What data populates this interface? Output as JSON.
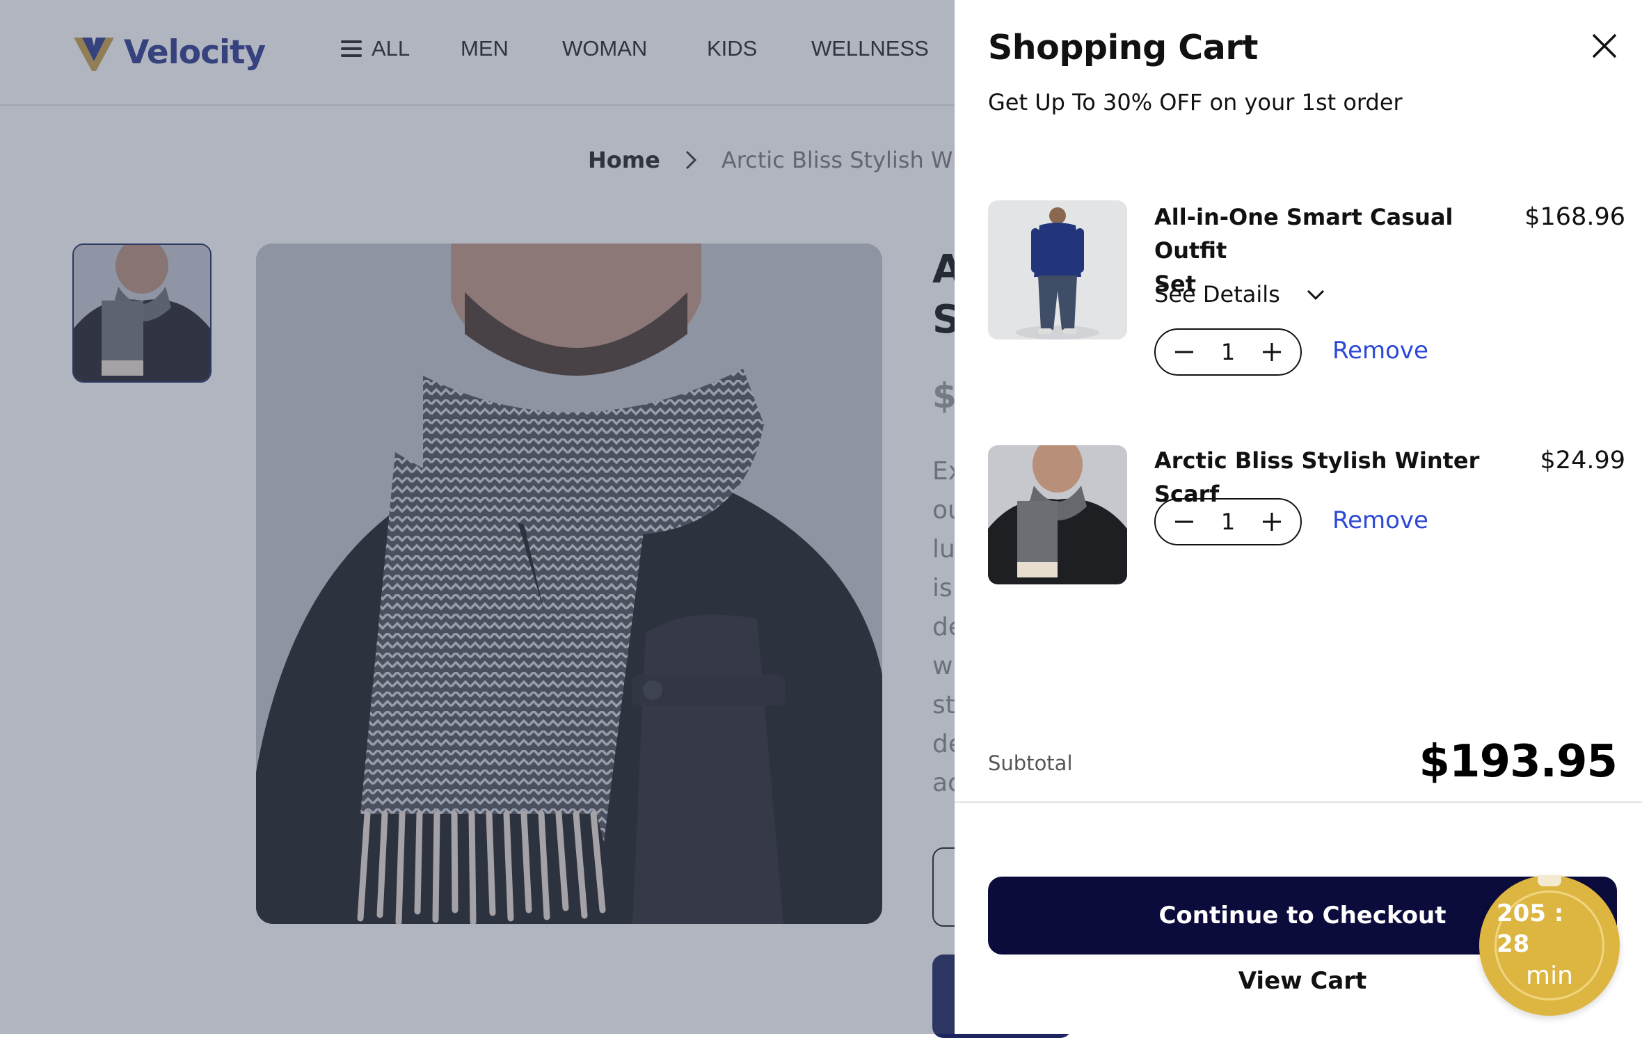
{
  "site": {
    "logo_text": "Velocity",
    "nav": [
      "ALL",
      "MEN",
      "WOMAN",
      "KIDS",
      "WELLNESS"
    ]
  },
  "breadcrumb": {
    "home": "Home",
    "current": "Arctic Bliss Stylish Win"
  },
  "product": {
    "title_line1": "A",
    "title_line2": "S",
    "price_fragment": "$",
    "desc_fragments": [
      "Ex",
      "ou",
      "lu",
      "is",
      "de",
      "w",
      "st",
      "de",
      "ac"
    ]
  },
  "cart": {
    "title": "Shopping Cart",
    "promo": "Get Up To 30% OFF on your 1st order",
    "items": [
      {
        "name": "All-in-One Smart Casual Outfit Set",
        "name_line1": "All-in-One Smart Casual Outfit",
        "name_line2": "Set",
        "price": "$168.96",
        "details_label": "See Details",
        "quantity": "1",
        "remove_label": "Remove"
      },
      {
        "name": "Arctic Bliss Stylish Winter Scarf",
        "price": "$24.99",
        "quantity": "1",
        "remove_label": "Remove"
      }
    ],
    "subtotal_label": "Subtotal",
    "subtotal_value": "$193.95",
    "checkout_label": "Continue to Checkout",
    "view_cart_label": "View Cart"
  },
  "timer": {
    "time": "205 : 28",
    "unit": "min"
  },
  "colors": {
    "brand_blue": "#2b3a8c",
    "brand_gold": "#c9a04a",
    "checkout_bg": "#0b0c3b",
    "link_blue": "#2b49d6",
    "timer_gold": "#ddb541"
  }
}
